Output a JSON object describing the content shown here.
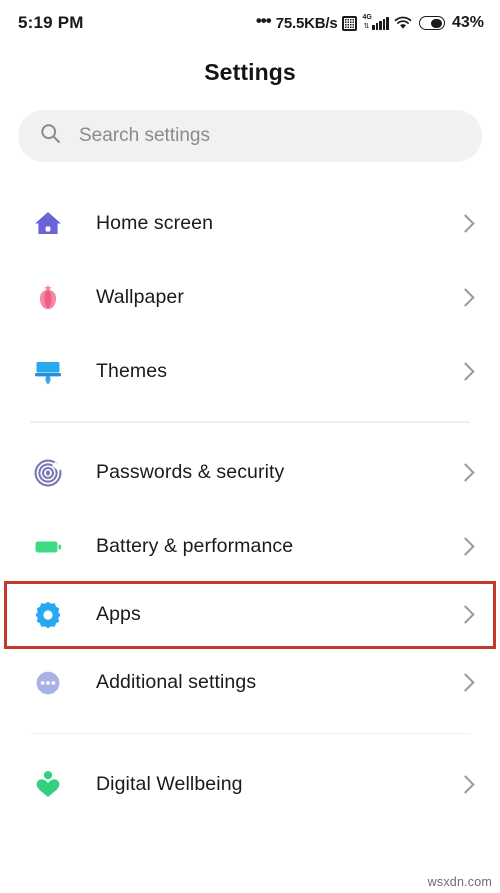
{
  "statusbar": {
    "time": "5:19 PM",
    "dots": "•••",
    "network_speed": "75.5KB/s",
    "sim_icon": "sim-card-icon",
    "signal_label": "4G",
    "signal_arrows": "⇅",
    "wifi_icon": "wifi-icon",
    "battery_icon": "battery-icon",
    "battery_percent": "43%"
  },
  "header": {
    "title": "Settings"
  },
  "search": {
    "icon": "search-icon",
    "placeholder": "Search settings",
    "value": ""
  },
  "groups": [
    {
      "items": [
        {
          "label": "Home screen",
          "icon": "home-icon",
          "chevron": "chevron-right-icon",
          "highlighted": false
        },
        {
          "label": "Wallpaper",
          "icon": "tulip-flower-icon",
          "chevron": "chevron-right-icon",
          "highlighted": false
        },
        {
          "label": "Themes",
          "icon": "paint-brush-icon",
          "chevron": "chevron-right-icon",
          "highlighted": false
        }
      ]
    },
    {
      "items": [
        {
          "label": "Passwords & security",
          "icon": "fingerprint-icon",
          "chevron": "chevron-right-icon",
          "highlighted": false
        },
        {
          "label": "Battery & performance",
          "icon": "battery-icon",
          "chevron": "chevron-right-icon",
          "highlighted": false
        },
        {
          "label": "Apps",
          "icon": "gear-icon",
          "chevron": "chevron-right-icon",
          "highlighted": true
        },
        {
          "label": "Additional settings",
          "icon": "more-dots-circle-icon",
          "chevron": "chevron-right-icon",
          "highlighted": false
        }
      ]
    },
    {
      "items": [
        {
          "label": "Digital Wellbeing",
          "icon": "person-heart-icon",
          "chevron": "chevron-right-icon",
          "highlighted": false
        }
      ]
    }
  ],
  "colors": {
    "home": "#6c63d8",
    "wallpaper": "#f2607f",
    "themes": "#29a8f0",
    "passwords": "#7a77b5",
    "battery": "#3ddc84",
    "apps": "#29a8f0",
    "additional": "#aab0e8",
    "wellbeing": "#35d07f",
    "highlight_border": "#c0392b",
    "search_bg": "#f1f1f1"
  },
  "watermark": "wsxdn.com"
}
